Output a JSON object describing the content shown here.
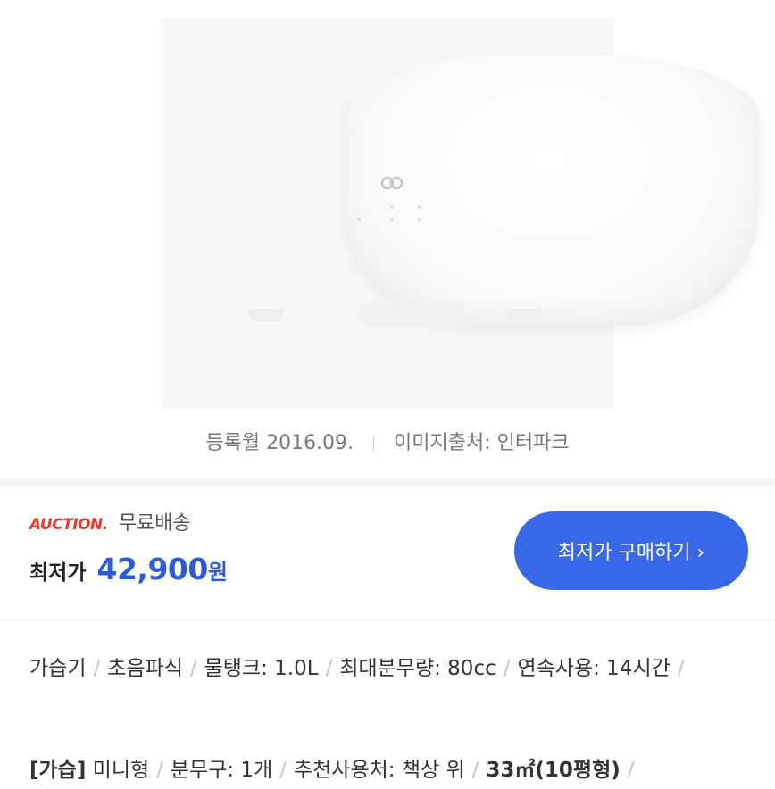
{
  "caption": {
    "registered": "등록월 2016.09.",
    "image_source": "이미지출처: 인터파크"
  },
  "seller": {
    "brand": "AUCTION.",
    "shipping": "무료배송"
  },
  "price": {
    "label": "최저가",
    "value": "42,900",
    "unit": "원"
  },
  "buy_button": {
    "label": "최저가 구매하기 ›"
  },
  "specs": [
    "가습기",
    "초음파식",
    "물탱크: 1.0L",
    "최대분무량: 80cc",
    "연속사용: 14시간"
  ],
  "specs2": {
    "tag": "[가습]",
    "items": [
      "미니형",
      "분무구: 1개",
      "추천사용처: 책상 위",
      "33㎡(10평형)"
    ]
  },
  "colors": {
    "accent": "#3868e8",
    "price": "#2b5adc",
    "auction": "#e8382e"
  }
}
